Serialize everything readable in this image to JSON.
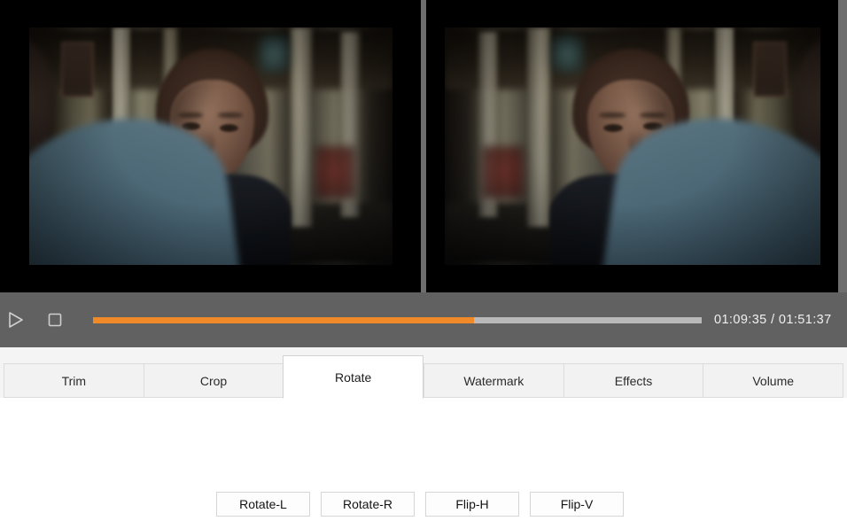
{
  "player": {
    "play_label": "Play",
    "play_icon": "play-triangle-icon",
    "stop_label": "Stop",
    "stop_icon": "stop-square-icon",
    "current_time": "01:09:35",
    "total_time": "01:51:37",
    "timecode": "01:09:35 / 01:51:37",
    "progress_percent": 62.6,
    "progress_fill_color": "#f08a28",
    "progress_track_color": "#b9b9b9",
    "bar_background": "#616161"
  },
  "preview": {
    "source_label": "Source preview",
    "output_label": "Output preview",
    "output_transform": "flip-horizontal"
  },
  "tabs": [
    {
      "label": "Trim",
      "active": false
    },
    {
      "label": "Crop",
      "active": false
    },
    {
      "label": "Rotate",
      "active": true
    },
    {
      "label": "Watermark",
      "active": false
    },
    {
      "label": "Effects",
      "active": false
    },
    {
      "label": "Volume",
      "active": false
    }
  ],
  "rotate_panel": {
    "buttons": [
      {
        "label": "Rotate-L"
      },
      {
        "label": "Rotate-R"
      },
      {
        "label": "Flip-H"
      },
      {
        "label": "Flip-V"
      }
    ]
  }
}
